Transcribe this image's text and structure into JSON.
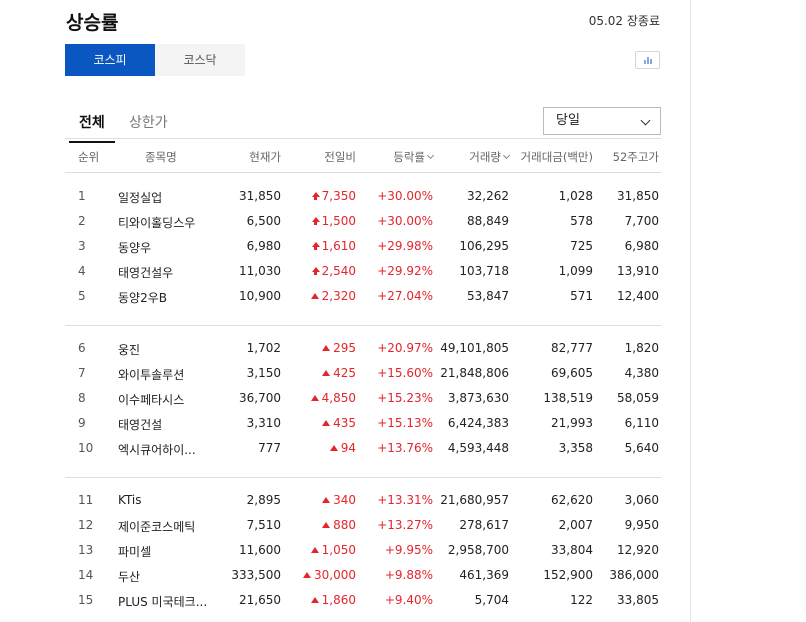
{
  "page": {
    "title": "상승률",
    "date": "05.02 장종료"
  },
  "market_tabs": [
    "코스피",
    "코스닥"
  ],
  "sub_tabs": [
    "전체",
    "상한가"
  ],
  "period_select": "당일",
  "columns": [
    "순위",
    "종목명",
    "현재가",
    "전일비",
    "등락률",
    "거래량",
    "거래대금(백만)",
    "52주고가"
  ],
  "colors": {
    "accent": "#0b57c2",
    "up": "#e4252c"
  },
  "rows": [
    {
      "rank": "1",
      "name": "일정실업",
      "price": "31,850",
      "change": "7,350",
      "limit": true,
      "rate": "+30.00%",
      "volume": "32,262",
      "amount": "1,028",
      "high52": "31,850"
    },
    {
      "rank": "2",
      "name": "티와이홀딩스우",
      "price": "6,500",
      "change": "1,500",
      "limit": true,
      "rate": "+30.00%",
      "volume": "88,849",
      "amount": "578",
      "high52": "7,700"
    },
    {
      "rank": "3",
      "name": "동양우",
      "price": "6,980",
      "change": "1,610",
      "limit": true,
      "rate": "+29.98%",
      "volume": "106,295",
      "amount": "725",
      "high52": "6,980"
    },
    {
      "rank": "4",
      "name": "태영건설우",
      "price": "11,030",
      "change": "2,540",
      "limit": true,
      "rate": "+29.92%",
      "volume": "103,718",
      "amount": "1,099",
      "high52": "13,910"
    },
    {
      "rank": "5",
      "name": "동양2우B",
      "price": "10,900",
      "change": "2,320",
      "limit": false,
      "rate": "+27.04%",
      "volume": "53,847",
      "amount": "571",
      "high52": "12,400"
    },
    {
      "rank": "6",
      "name": "웅진",
      "price": "1,702",
      "change": "295",
      "limit": false,
      "rate": "+20.97%",
      "volume": "49,101,805",
      "amount": "82,777",
      "high52": "1,820"
    },
    {
      "rank": "7",
      "name": "와이투솔루션",
      "price": "3,150",
      "change": "425",
      "limit": false,
      "rate": "+15.60%",
      "volume": "21,848,806",
      "amount": "69,605",
      "high52": "4,380"
    },
    {
      "rank": "8",
      "name": "이수페타시스",
      "price": "36,700",
      "change": "4,850",
      "limit": false,
      "rate": "+15.23%",
      "volume": "3,873,630",
      "amount": "138,519",
      "high52": "58,059"
    },
    {
      "rank": "9",
      "name": "태영건설",
      "price": "3,310",
      "change": "435",
      "limit": false,
      "rate": "+15.13%",
      "volume": "6,424,383",
      "amount": "21,993",
      "high52": "6,110"
    },
    {
      "rank": "10",
      "name": "엑시큐어하이...",
      "price": "777",
      "change": "94",
      "limit": false,
      "rate": "+13.76%",
      "volume": "4,593,448",
      "amount": "3,358",
      "high52": "5,640"
    },
    {
      "rank": "11",
      "name": "KTis",
      "price": "2,895",
      "change": "340",
      "limit": false,
      "rate": "+13.31%",
      "volume": "21,680,957",
      "amount": "62,620",
      "high52": "3,060"
    },
    {
      "rank": "12",
      "name": "제이준코스메틱",
      "price": "7,510",
      "change": "880",
      "limit": false,
      "rate": "+13.27%",
      "volume": "278,617",
      "amount": "2,007",
      "high52": "9,950"
    },
    {
      "rank": "13",
      "name": "파미셀",
      "price": "11,600",
      "change": "1,050",
      "limit": false,
      "rate": "+9.95%",
      "volume": "2,958,700",
      "amount": "33,804",
      "high52": "12,920"
    },
    {
      "rank": "14",
      "name": "두산",
      "price": "333,500",
      "change": "30,000",
      "limit": false,
      "rate": "+9.88%",
      "volume": "461,369",
      "amount": "152,900",
      "high52": "386,000"
    },
    {
      "rank": "15",
      "name": "PLUS 미국테크...",
      "price": "21,650",
      "change": "1,860",
      "limit": false,
      "rate": "+9.40%",
      "volume": "5,704",
      "amount": "122",
      "high52": "33,805"
    }
  ]
}
